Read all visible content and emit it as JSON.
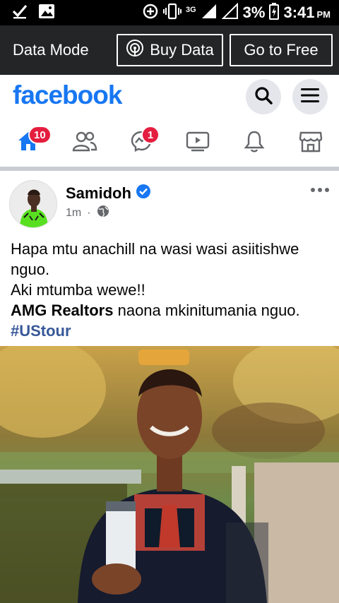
{
  "status_bar": {
    "network": "3G",
    "battery": "3%",
    "time": "3:41",
    "ampm": "PM"
  },
  "data_mode": {
    "label": "Data Mode",
    "buy_data": "Buy Data",
    "go_to_free": "Go to Free"
  },
  "header": {
    "logo": "facebook"
  },
  "tabs": {
    "home_badge": "10",
    "messenger_badge": "1"
  },
  "post": {
    "author": "Samidoh",
    "time": "1m",
    "bullet": "·",
    "line1": "Hapa mtu anachill na wasi wasi asiitishwe nguo.",
    "line2": "Aki mtumba wewe!!",
    "mention": "AMG Realtors",
    "line3_rest": " naona mkinitumania nguo.",
    "hashtag": "#UStour"
  },
  "colors": {
    "brand": "#1877f2",
    "badge": "#e41e3f",
    "hashtag": "#385898"
  }
}
